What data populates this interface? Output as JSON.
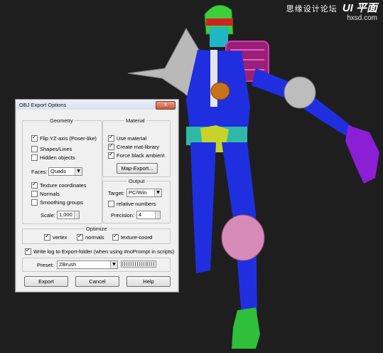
{
  "watermark": {
    "site_name": "思缘设计论坛",
    "logo": "UI 平面",
    "url": "hxsd.com"
  },
  "dialog": {
    "title": "OBJ Export Options",
    "close_label": "x",
    "geometry": {
      "label": "Geometry",
      "flip_yz": {
        "label": "Flip YZ-axis (Poser-like)",
        "checked": true
      },
      "shapes_lines": {
        "label": "Shapes/Lines",
        "checked": false
      },
      "hidden_objects": {
        "label": "Hidden objects",
        "checked": false
      },
      "faces_label": "Faces:",
      "faces_value": "Quads",
      "texture_coordinates": {
        "label": "Texture coordinates",
        "checked": true
      },
      "normals": {
        "label": "Normals",
        "checked": false
      },
      "smoothing_groups": {
        "label": "Smoothing groups",
        "checked": false
      },
      "scale_label": "Scale:",
      "scale_value": "1,000"
    },
    "material": {
      "label": "Material",
      "use_material": {
        "label": "Use material",
        "checked": true
      },
      "create_mat_library": {
        "label": "Create mat-library",
        "checked": true
      },
      "force_black_ambient": {
        "label": "Force black ambient",
        "checked": true
      },
      "map_export_label": "Map-Export..."
    },
    "output": {
      "label": "Output",
      "target_label": "Target:",
      "target_value": "PC/Win",
      "relative_numbers": {
        "label": "relative numbers",
        "checked": false
      },
      "precision_label": "Precision:",
      "precision_value": "4"
    },
    "optimize": {
      "label": "Optimize",
      "vertex": {
        "label": "vertex",
        "checked": true
      },
      "normals": {
        "label": "normals",
        "checked": true
      },
      "texture_coord": {
        "label": "texture-coord",
        "checked": true
      }
    },
    "write_log": {
      "label": "Write log to Export-folder (when using #noPrompt in scripts)",
      "checked": true
    },
    "preset_label": "Preset:",
    "preset_value": "ZBrush",
    "buttons": {
      "export": "Export",
      "cancel": "Cancel",
      "help": "Help"
    }
  },
  "colors": {
    "viewport_bg": "#1e1e1e",
    "character_blue": "#1f2fe0",
    "character_purple": "#8a1fd6",
    "character_green": "#2fbf3a"
  }
}
